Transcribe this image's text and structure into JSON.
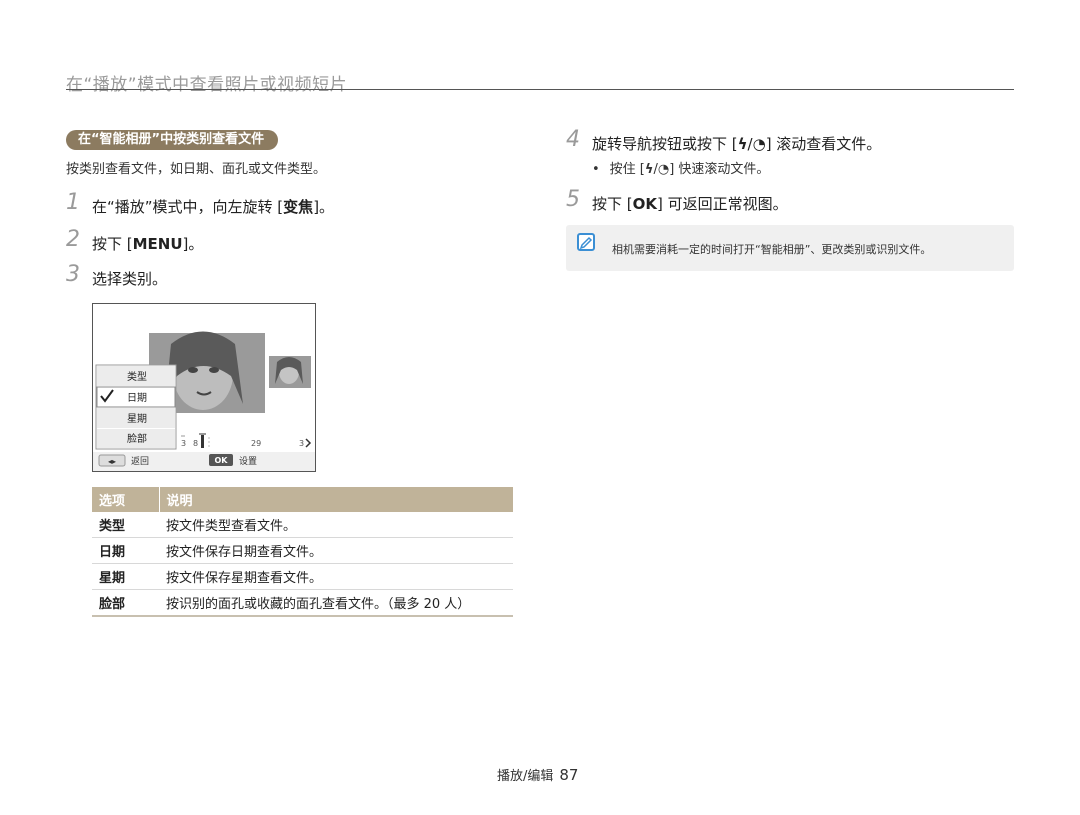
{
  "header": {
    "title": "在“播放”模式中查看照片或视频短片"
  },
  "section": {
    "pill": "在“智能相册”中按类别查看文件",
    "description": "按类别查看文件，如日期、面孔或文件类型。"
  },
  "left_steps": [
    {
      "num": "1",
      "pre": "在“播放”模式中，向左旋转 [",
      "key": "变焦",
      "post": "]。"
    },
    {
      "num": "2",
      "pre": "按下 [",
      "key": "MENU",
      "post": "]。"
    },
    {
      "num": "3",
      "pre": "选择类别。",
      "key": "",
      "post": ""
    }
  ],
  "camera_screen": {
    "menu_items": [
      "类型",
      "日期",
      "星期",
      "脸部"
    ],
    "selected_index": 1,
    "scale_labels": [
      "3",
      "8",
      "29",
      "3"
    ],
    "back_label": "返回",
    "ok_key": "OK",
    "ok_label": "设置"
  },
  "table": {
    "headers": [
      "选项",
      "说明"
    ],
    "rows": [
      {
        "option": "类型",
        "desc": "按文件类型查看文件。"
      },
      {
        "option": "日期",
        "desc": "按文件保存日期查看文件。"
      },
      {
        "option": "星期",
        "desc": "按文件保存星期查看文件。"
      },
      {
        "option": "脸部",
        "desc": "按识别的面孔或收藏的面孔查看文件。（最多 20 人）"
      }
    ]
  },
  "right_steps": {
    "step4": {
      "num": "4",
      "pre": "旋转导航按钮或按下 [",
      "post": "] 滚动查看文件。"
    },
    "bullet": {
      "pre": "按住 [",
      "post": "] 快速滚动文件。"
    },
    "step5": {
      "num": "5",
      "pre": "按下 [",
      "key": "OK",
      "post": "] 可返回正常视图。"
    }
  },
  "note": {
    "text": "相机需要消耗一定的时间打开“智能相册”、更改类别或识别文件。"
  },
  "footer": {
    "section": "播放/编辑",
    "page": "87"
  },
  "colors": {
    "pill_bg": "#8c7b60",
    "table_header_bg": "#c0b399",
    "note_icon": "#3b8fd4"
  }
}
